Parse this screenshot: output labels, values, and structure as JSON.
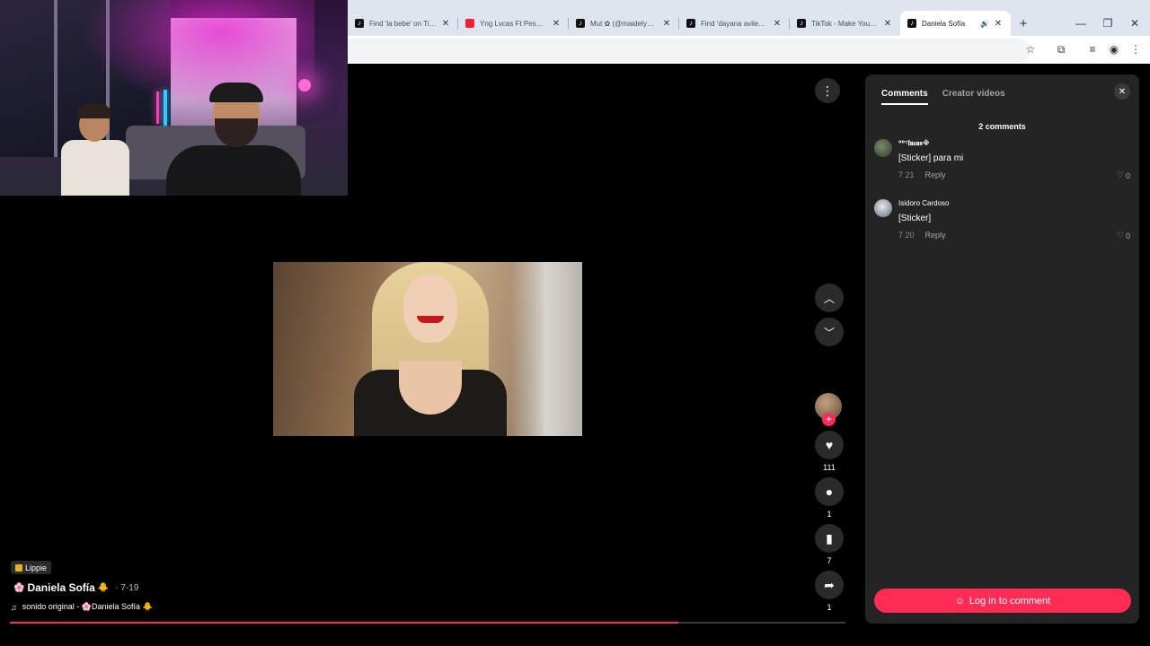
{
  "colors": {
    "accent": "#fe2c55",
    "panel": "#242424",
    "background": "#000000"
  },
  "browser": {
    "tabs": [
      {
        "favicon": "tiktok-icon",
        "title": "Find 'la bebe' on TikTok",
        "active": false
      },
      {
        "favicon": "youtube-icon",
        "title": "Yng Lvcas Ft Peso Pluma",
        "active": false
      },
      {
        "favicon": "tiktok-icon",
        "title": "Mut ✿ (@maidelyngar",
        "active": false
      },
      {
        "favicon": "tiktok-icon",
        "title": "Find 'dayana aviles' on",
        "active": false
      },
      {
        "favicon": "tiktok-icon",
        "title": "TikTok - Make Your Day",
        "active": false
      },
      {
        "favicon": "tiktok-icon",
        "title": "Daniela Sofía",
        "active": true,
        "speaker": "🔊"
      }
    ],
    "new_tab": "+",
    "window_controls": {
      "minimize": "—",
      "restore": "❐",
      "close": "✕"
    },
    "toolbar_icons": {
      "star": "☆",
      "extensions": "⧉",
      "media": "≡",
      "profile": "◉",
      "menu": "⋮"
    }
  },
  "video": {
    "more": "⋮",
    "nav_up": "︿",
    "nav_down": "﹀",
    "follow": "+",
    "like_icon": "♥",
    "likes": "111",
    "comment_icon": "●",
    "comments": "1",
    "bookmark_icon": "▮",
    "saves": "7",
    "share_icon": "➦",
    "shares": "1",
    "music_tag": "Lippie",
    "author": "Daniela Sofía",
    "author_emoji_before": "🌸",
    "author_emoji_after": "🐥",
    "date": "· 7-19",
    "sound_icon": "♫",
    "sound": "sonido original - 🌸Daniela Sofía 🐥",
    "progress": 0.8
  },
  "comments_panel": {
    "tabs": {
      "comments": "Comments",
      "creator_videos": "Creator videos"
    },
    "close": "✕",
    "count": "2 comments",
    "comments": [
      {
        "user": "⁰⁰⁷𝖑𝖚𝖈𝖆𝖘※",
        "text": "[Sticker] para mi",
        "date": "7 21",
        "reply": "Reply",
        "likes": "0",
        "like_icon": "♡"
      },
      {
        "user": "Isidoro Cardoso",
        "text": "[Sticker]",
        "date": "7 20",
        "reply": "Reply",
        "likes": "0",
        "like_icon": "♡"
      }
    ],
    "login": "Log in to comment",
    "login_icon": "☺"
  }
}
